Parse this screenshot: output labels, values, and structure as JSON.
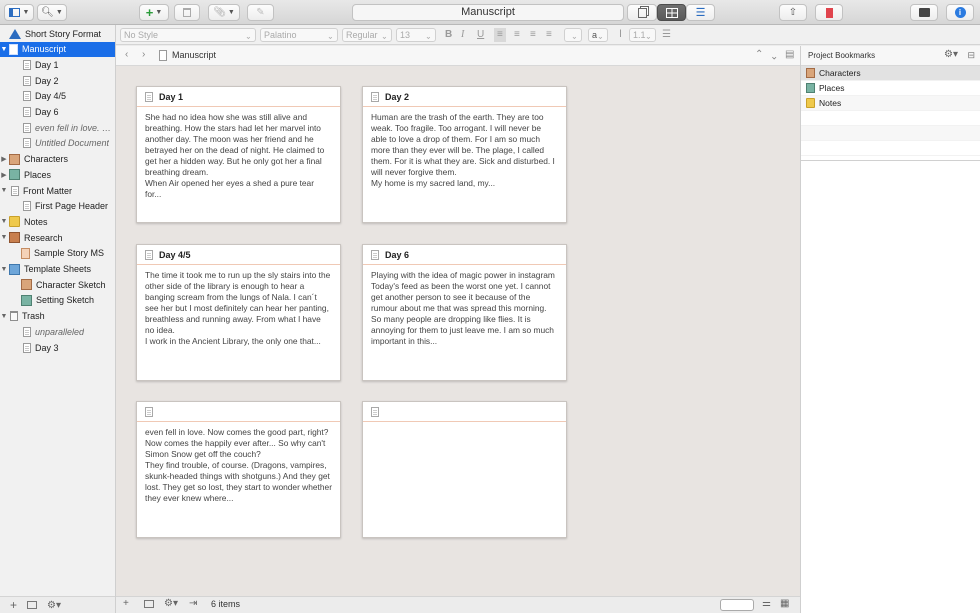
{
  "window": {
    "title": "Manuscript"
  },
  "toolbar": {
    "search_icon": "magnifier-icon",
    "add_icon": "plus-icon",
    "inspector_icon": "info-icon"
  },
  "format_bar": {
    "style": "No Style",
    "font": "Palatino",
    "weight": "Regular",
    "size": "13",
    "line_spacing": "1.1"
  },
  "binder": {
    "items": [
      {
        "label": "Short Story Format",
        "icon": "triangle",
        "indent": 0,
        "disc": ""
      },
      {
        "label": "Manuscript",
        "icon": "ms",
        "indent": 0,
        "disc": "▼",
        "selected": true
      },
      {
        "label": "Day 1",
        "icon": "doc",
        "indent": 1,
        "disc": ""
      },
      {
        "label": "Day 2",
        "icon": "doc",
        "indent": 1,
        "disc": ""
      },
      {
        "label": "Day 4/5",
        "icon": "doc",
        "indent": 1,
        "disc": ""
      },
      {
        "label": "Day 6",
        "icon": "doc",
        "indent": 1,
        "disc": ""
      },
      {
        "label": "even fell in love. N...",
        "icon": "doc",
        "indent": 1,
        "disc": "",
        "italic": true
      },
      {
        "label": "Untitled Document",
        "icon": "doc",
        "indent": 1,
        "disc": "",
        "italic": true
      },
      {
        "label": "Characters",
        "icon": "char",
        "indent": 0,
        "disc": "▶"
      },
      {
        "label": "Places",
        "icon": "place",
        "indent": 0,
        "disc": "▶"
      },
      {
        "label": "Front Matter",
        "icon": "doc",
        "indent": 0,
        "disc": "▼"
      },
      {
        "label": "First Page Header",
        "icon": "doc",
        "indent": 1,
        "disc": ""
      },
      {
        "label": "Notes",
        "icon": "folder",
        "indent": 0,
        "disc": "▼"
      },
      {
        "label": "Research",
        "icon": "research",
        "indent": 0,
        "disc": "▼"
      },
      {
        "label": "Sample Story MS",
        "icon": "sheet",
        "indent": 1,
        "disc": ""
      },
      {
        "label": "Template Sheets",
        "icon": "template",
        "indent": 0,
        "disc": "▼"
      },
      {
        "label": "Character Sketch",
        "icon": "char",
        "indent": 1,
        "disc": ""
      },
      {
        "label": "Setting Sketch",
        "icon": "place",
        "indent": 1,
        "disc": ""
      },
      {
        "label": "Trash",
        "icon": "trash",
        "indent": 0,
        "disc": "▼"
      },
      {
        "label": "unparalleled",
        "icon": "doc",
        "indent": 1,
        "disc": "",
        "italic": true
      },
      {
        "label": "Day 3",
        "icon": "doc",
        "indent": 1,
        "disc": ""
      }
    ]
  },
  "editor": {
    "header_title": "Manuscript",
    "item_count": "6 items",
    "cards": [
      {
        "title": "Day 1",
        "synopsis": "She had no idea how she was still alive and breathing. How the stars had let her marvel into another day. The moon was her friend and he betrayed her on the dead of night. He claimed to get her a hidden way. But he only got her a final breathing dream.\nWhen Air opened her eyes a shed a pure tear for..."
      },
      {
        "title": "Day 2",
        "synopsis": "Human are the trash of the earth. They are too weak. Too fragile. Too arrogant. I will never be able to love a drop of them. For I am so much more than they ever will be. The plage, I called them. For it is what they are. Sick and disturbed. I will never forgive them.\nMy home is my sacred land, my..."
      },
      {
        "title": "Day 4/5",
        "synopsis": "The time it took me to run up the sly stairs into the other side of the library is enough to hear a banging scream from the lungs of Nala. I can´t see her but I most definitely can hear her panting, breathless and running away. From what I have no idea.\nI work in the Ancient Library, the only one that..."
      },
      {
        "title": "Day 6",
        "synopsis": "Playing with the idea of magic power in instagram\nToday's feed as been the worst one yet. I cannot get another person to see it because of the rumour about me that was spread this morning. So many people are dropping like flies. It is annoying for them to just leave me. I am so much important in this..."
      },
      {
        "title": "",
        "synopsis": "even fell in love. Now comes the good part, right? Now comes the happily ever after... So why can't Simon Snow get off the couch?\nThey find trouble, of course. (Dragons, vampires, skunk-headed things with shotguns.) And they get lost. They get so lost, they start to wonder whether they ever knew where..."
      },
      {
        "title": "",
        "synopsis": ""
      }
    ]
  },
  "inspector": {
    "title": "Project Bookmarks",
    "bookmarks": [
      {
        "label": "Characters",
        "icon": "char"
      },
      {
        "label": "Places",
        "icon": "place"
      },
      {
        "label": "Notes",
        "icon": "folder"
      }
    ]
  }
}
